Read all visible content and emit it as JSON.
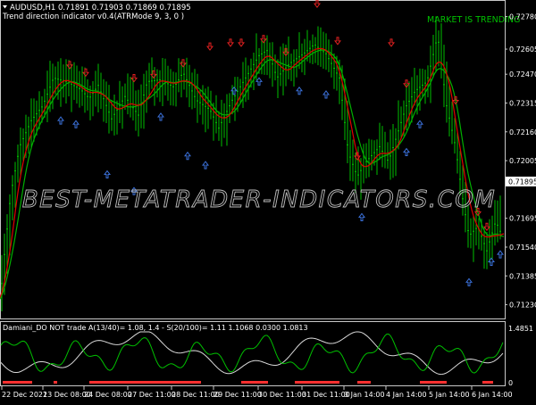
{
  "window": {
    "symbol_line": "AUDUSD,H1  0.71891 0.71903 0.71869 0.71895",
    "indicator_line": "Trend direction indicator v0.4(ATRMode 9, 3, 0 )",
    "status_text": "MARKET IS TRENDING",
    "watermark": "BEST-METATRADER-INDICATORS.COM",
    "colors": {
      "background": "#000000",
      "bull_candle": "#00c000",
      "trend_red": "#e00000",
      "trend_green": "#00b000",
      "arrow_up": "#3a6fd8",
      "arrow_down": "#e02020",
      "status": "#00c000",
      "price_tag_bg": "#ffffff",
      "osc_green": "#00c000",
      "osc_white": "#d8d8d8",
      "osc_red_bar": "#ff3030"
    },
    "icons": {
      "up_arrow": "up-arrow-icon",
      "down_arrow": "down-arrow-icon"
    }
  },
  "subwindow": {
    "label": "Damiani_DO NOT trade A(13/40)= 1.08, 1.4 - S(20/100)= 1.11  1.1068 0.0300 1.0813",
    "max_label": "1.4851",
    "min_label": "0"
  },
  "price_axis": {
    "labels": [
      "0.72780",
      "0.72605",
      "0.72470",
      "0.72315",
      "0.72160",
      "0.72005",
      "0.71895",
      "0.71695",
      "0.71540",
      "0.71385",
      "0.71230"
    ],
    "current_price": "0.71895"
  },
  "time_axis": {
    "labels": [
      "22 Dec 2021",
      "23 Dec 08:00",
      "24 Dec 08:00",
      "27 Dec 11:00",
      "28 Dec 11:00",
      "29 Dec 11:00",
      "30 Dec 11:00",
      "31 Dec 11:00",
      "3 Jan 14:00",
      "4 Jan 14:00",
      "5 Jan 14:00",
      "6 Jan 14:00"
    ]
  },
  "chart_data": {
    "type": "line",
    "ylim": [
      0.7118,
      0.7285
    ],
    "anchors": [
      [
        0,
        0.7124
      ],
      [
        5,
        0.715
      ],
      [
        12,
        0.7182
      ],
      [
        22,
        0.7208
      ],
      [
        35,
        0.7222
      ],
      [
        48,
        0.723
      ],
      [
        60,
        0.7245
      ],
      [
        75,
        0.7243
      ],
      [
        90,
        0.7239
      ],
      [
        100,
        0.7234
      ],
      [
        110,
        0.7241
      ],
      [
        125,
        0.7223
      ],
      [
        140,
        0.7235
      ],
      [
        155,
        0.7225
      ],
      [
        165,
        0.7243
      ],
      [
        180,
        0.7244
      ],
      [
        195,
        0.724
      ],
      [
        205,
        0.7248
      ],
      [
        220,
        0.7233
      ],
      [
        235,
        0.7228
      ],
      [
        245,
        0.7218
      ],
      [
        260,
        0.7233
      ],
      [
        275,
        0.7245
      ],
      [
        290,
        0.7257
      ],
      [
        300,
        0.726
      ],
      [
        310,
        0.7245
      ],
      [
        325,
        0.7253
      ],
      [
        340,
        0.7258
      ],
      [
        352,
        0.7263
      ],
      [
        365,
        0.7258
      ],
      [
        380,
        0.7245
      ],
      [
        390,
        0.7205
      ],
      [
        400,
        0.7192
      ],
      [
        410,
        0.72
      ],
      [
        425,
        0.7208
      ],
      [
        435,
        0.72
      ],
      [
        445,
        0.7215
      ],
      [
        455,
        0.723
      ],
      [
        465,
        0.7238
      ],
      [
        478,
        0.7243
      ],
      [
        490,
        0.7268
      ],
      [
        500,
        0.723
      ],
      [
        510,
        0.7208
      ],
      [
        518,
        0.718
      ],
      [
        525,
        0.716
      ],
      [
        535,
        0.7165
      ],
      [
        545,
        0.7152
      ],
      [
        555,
        0.7168
      ],
      [
        565,
        0.7157
      ]
    ],
    "arrows_down": [
      [
        78,
        0.725
      ],
      [
        96,
        0.7246
      ],
      [
        150,
        0.7243
      ],
      [
        172,
        0.7245
      ],
      [
        205,
        0.7251
      ],
      [
        235,
        0.726
      ],
      [
        258,
        0.7262
      ],
      [
        270,
        0.7262
      ],
      [
        295,
        0.7264
      ],
      [
        320,
        0.7257
      ],
      [
        355,
        0.7283
      ],
      [
        378,
        0.7263
      ],
      [
        400,
        0.7201
      ],
      [
        438,
        0.7262
      ],
      [
        455,
        0.724
      ],
      [
        510,
        0.7231
      ],
      [
        535,
        0.7171
      ],
      [
        545,
        0.7163
      ]
    ],
    "arrows_up": [
      [
        68,
        0.7224
      ],
      [
        85,
        0.7222
      ],
      [
        120,
        0.7195
      ],
      [
        150,
        0.7186
      ],
      [
        180,
        0.7226
      ],
      [
        210,
        0.7205
      ],
      [
        230,
        0.72
      ],
      [
        262,
        0.724
      ],
      [
        290,
        0.7245
      ],
      [
        335,
        0.724
      ],
      [
        365,
        0.7238
      ],
      [
        405,
        0.7172
      ],
      [
        455,
        0.7207
      ],
      [
        470,
        0.7222
      ],
      [
        525,
        0.7137
      ],
      [
        550,
        0.7148
      ],
      [
        560,
        0.7152
      ]
    ]
  }
}
